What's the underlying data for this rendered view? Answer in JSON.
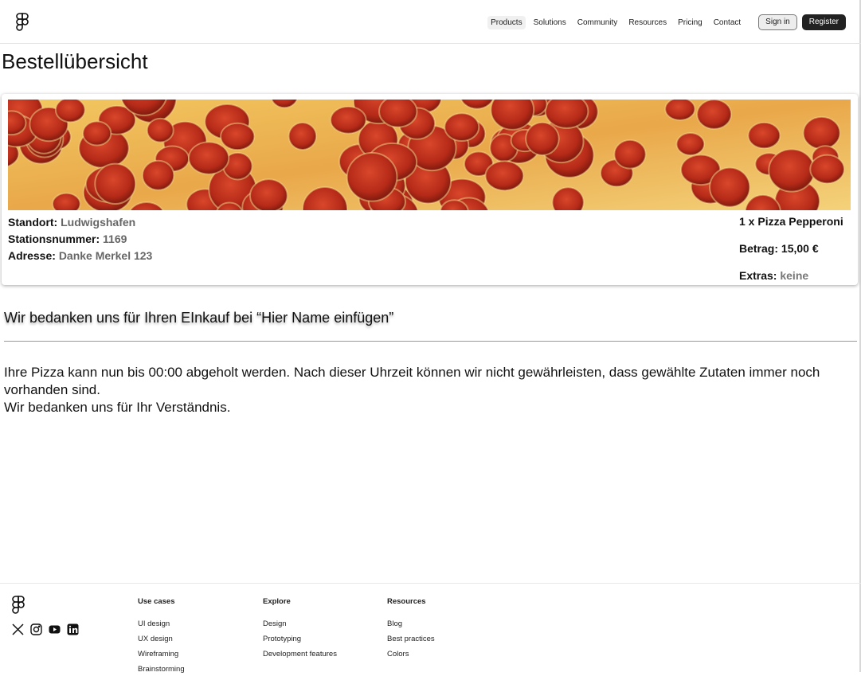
{
  "header": {
    "logo_icon": "figma-logo-icon",
    "nav": [
      "Products",
      "Solutions",
      "Community",
      "Resources",
      "Pricing",
      "Contact"
    ],
    "active_nav": "Products",
    "sign_in": "Sign in",
    "register": "Register"
  },
  "page": {
    "title": "Bestellübersicht"
  },
  "order": {
    "image": "pepperoni-pizza-photo",
    "location_label": "Standort:",
    "location_value": "Ludwigshafen",
    "station_label": "Stationsnummer:",
    "station_value": "1169",
    "address_label": "Adresse:",
    "address_value": "Danke Merkel 123",
    "item": "1 x Pizza Pepperoni",
    "amount_label": "Betrag:",
    "amount_value": "15,00 €",
    "extras_label": "Extras:",
    "extras_value": "keine"
  },
  "message": {
    "thanks": "Wir bedanken uns für Ihren EInkauf bei “Hier Name einfügen”",
    "line1": "Ihre Pizza kann nun bis 00:00 abgeholt werden. Nach dieser Uhrzeit können wir nicht gewährleisten, dass gewählte Zutaten immer noch vorhanden sind.",
    "line2": "Wir bedanken uns für Ihr Verständnis."
  },
  "footer": {
    "social_icons": [
      "x-icon",
      "instagram-icon",
      "youtube-icon",
      "linkedin-icon"
    ],
    "columns": [
      {
        "heading": "Use cases",
        "links": [
          "UI design",
          "UX design",
          "Wireframing",
          "Brainstorming"
        ]
      },
      {
        "heading": "Explore",
        "links": [
          "Design",
          "Prototyping",
          "Development features"
        ]
      },
      {
        "heading": "Resources",
        "links": [
          "Blog",
          "Best practices",
          "Colors"
        ]
      }
    ]
  },
  "colors": {
    "accent_dark": "#222222",
    "muted_text": "#666666"
  }
}
